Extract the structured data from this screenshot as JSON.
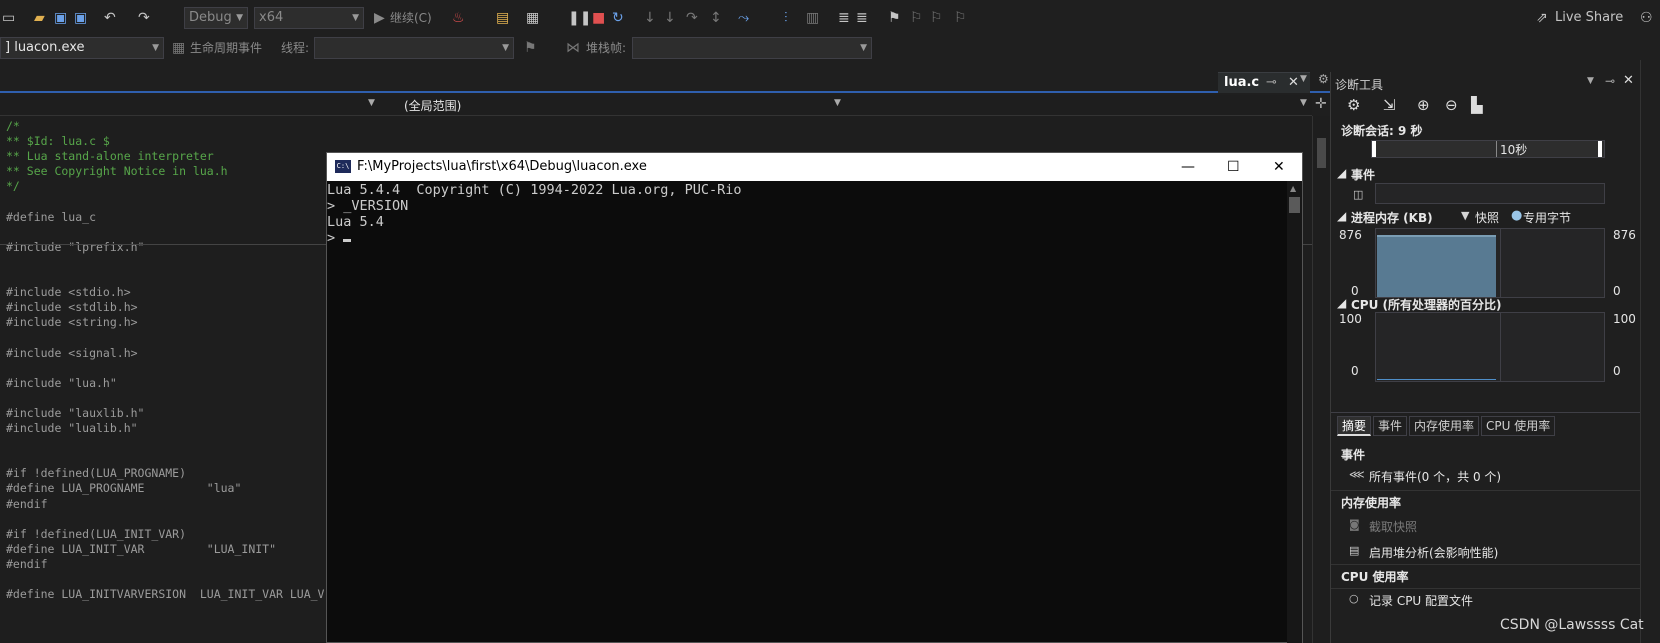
{
  "toolbar": {
    "config": "Debug",
    "platform": "x64",
    "continue_label": "继续(C)",
    "live_share": "Live Share"
  },
  "toolbar2": {
    "process": "] luacon.exe",
    "lifecycle_label": "生命周期事件",
    "thread_label": "线程:",
    "stackframe_label": "堆栈帧:"
  },
  "editor": {
    "tab_name": "lua.c",
    "scope": "(全局范围)",
    "lines": [
      {
        "text": "/*",
        "cls": "cm"
      },
      {
        "text": "** $Id: lua.c $",
        "cls": "cm"
      },
      {
        "text": "** Lua stand-alone interpreter",
        "cls": "cm"
      },
      {
        "text": "** See Copyright Notice in lua.h",
        "cls": "cm"
      },
      {
        "text": "*/",
        "cls": "cm"
      },
      {
        "text": "",
        "cls": ""
      },
      {
        "text": "#define lua_c",
        "cls": "pp"
      },
      {
        "text": "",
        "cls": ""
      },
      {
        "text": "#include \"lprefix.h\"",
        "cls": "pp"
      },
      {
        "text": "",
        "cls": ""
      },
      {
        "text": "",
        "cls": ""
      },
      {
        "text": "#include <stdio.h>",
        "cls": "pp"
      },
      {
        "text": "#include <stdlib.h>",
        "cls": "pp"
      },
      {
        "text": "#include <string.h>",
        "cls": "pp"
      },
      {
        "text": "",
        "cls": ""
      },
      {
        "text": "#include <signal.h>",
        "cls": "pp"
      },
      {
        "text": "",
        "cls": ""
      },
      {
        "text": "#include \"lua.h\"",
        "cls": "pp"
      },
      {
        "text": "",
        "cls": ""
      },
      {
        "text": "#include \"lauxlib.h\"",
        "cls": "pp"
      },
      {
        "text": "#include \"lualib.h\"",
        "cls": "pp"
      },
      {
        "text": "",
        "cls": ""
      },
      {
        "text": "",
        "cls": ""
      },
      {
        "text": "#if !defined(LUA_PROGNAME)",
        "cls": "pp"
      },
      {
        "text": "#define LUA_PROGNAME         \"lua\"",
        "cls": "pp"
      },
      {
        "text": "#endif",
        "cls": "pp"
      },
      {
        "text": "",
        "cls": ""
      },
      {
        "text": "#if !defined(LUA_INIT_VAR)",
        "cls": "pp"
      },
      {
        "text": "#define LUA_INIT_VAR         \"LUA_INIT\"",
        "cls": "pp"
      },
      {
        "text": "#endif",
        "cls": "pp"
      },
      {
        "text": "",
        "cls": ""
      },
      {
        "text": "#define LUA_INITVARVERSION  LUA_INIT_VAR LUA_V",
        "cls": "pp"
      }
    ]
  },
  "console": {
    "title": "F:\\MyProjects\\lua\\first\\x64\\Debug\\luacon.exe",
    "icon_label": "C:\\",
    "lines": [
      "Lua 5.4.4  Copyright (C) 1994-2022 Lua.org, PUC-Rio",
      "> _VERSION",
      "Lua 5.4",
      "> "
    ]
  },
  "diag": {
    "title": "诊断工具",
    "session": "诊断会话: 9 秒",
    "timeline_label": "10秒",
    "events_header": "事件",
    "memory_header": "进程内存 (KB)",
    "legend_snapshot": "快照",
    "legend_private": "专用字节",
    "mem_max": "876",
    "mem_min": "0",
    "cpu_header": "CPU (所有处理器的百分比)",
    "cpu_max": "100",
    "cpu_min": "0",
    "tabs": [
      "摘要",
      "事件",
      "内存使用率",
      "CPU 使用率"
    ],
    "sec_events": "事件",
    "all_events": "所有事件(0 个，共 0 个)",
    "sec_memory": "内存使用率",
    "take_snapshot": "截取快照",
    "heap_profile": "启用堆分析(会影响性能)",
    "sec_cpu": "CPU 使用率",
    "record_cpu": "记录 CPU 配置文件",
    "memory_fill_fraction": 0.92
  },
  "watermark": "CSDN @Lawssss Cat",
  "colors": {
    "accent": "#2f5fae",
    "memory_fill": "#587a92",
    "legend_blue": "#3c8ee6"
  }
}
